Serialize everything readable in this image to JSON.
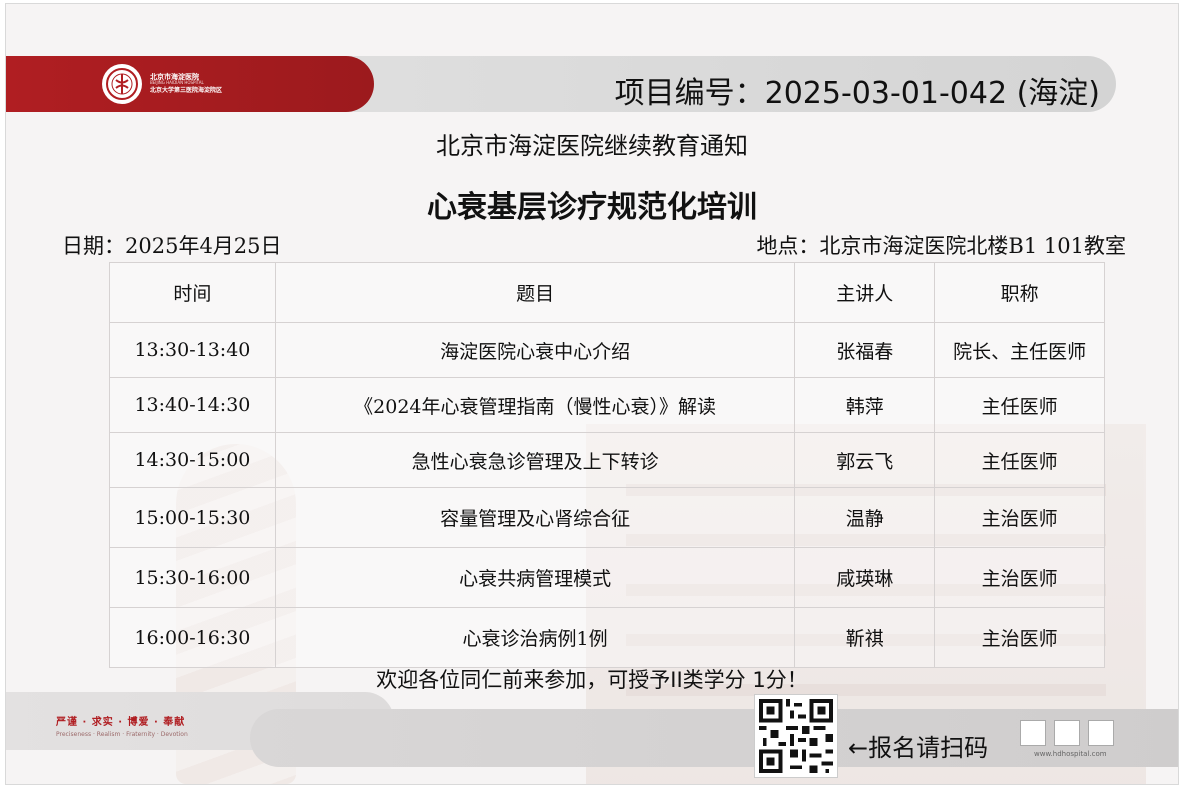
{
  "header": {
    "logo_name_cn": "北京市海淀医院",
    "logo_name_en": "BEIJING HAIDIAN HOSPITAL",
    "logo_sub_cn": "北京大学第三医院海淀院区",
    "project_no": "项目编号：2025-03-01-042 (海淀)"
  },
  "notice": "北京市海淀医院继续教育通知",
  "title": "心衰基层诊疗规范化培训",
  "date": "日期：2025年4月25日",
  "place": "地点：北京市海淀医院北楼B1  101教室",
  "table": {
    "headers": [
      "时间",
      "题目",
      "主讲人",
      "职称"
    ],
    "rows": [
      [
        "13:30-13:40",
        "海淀医院心衰中心介绍",
        "张福春",
        "院长、主任医师"
      ],
      [
        "13:40-14:30",
        "《2024年心衰管理指南（慢性心衰）》解读",
        "韩萍",
        "主任医师"
      ],
      [
        "14:30-15:00",
        "急性心衰急诊管理及上下转诊",
        "郭云飞",
        "主任医师"
      ],
      [
        "15:00-15:30",
        "容量管理及心肾综合征",
        "温静",
        "主治医师"
      ],
      [
        "15:30-16:00",
        "心衰共病管理模式",
        "咸瑛琳",
        "主治医师"
      ],
      [
        "16:00-16:30",
        "心衰诊治病例1例",
        "靳祺",
        "主治医师"
      ]
    ]
  },
  "welcome": "欢迎各位同仁前来参加，可授予II类学分 1分！",
  "footer": {
    "motto_cn": "严谨 · 求实 · 博爱 · 奉献",
    "motto_en": "Preciseness · Realism · Fraternity · Devotion",
    "scan_text": "←报名请扫码",
    "website": "www.hdhospital.com"
  },
  "colors": {
    "brand_red": "#b01e22",
    "panel_gray": "#dadada"
  }
}
